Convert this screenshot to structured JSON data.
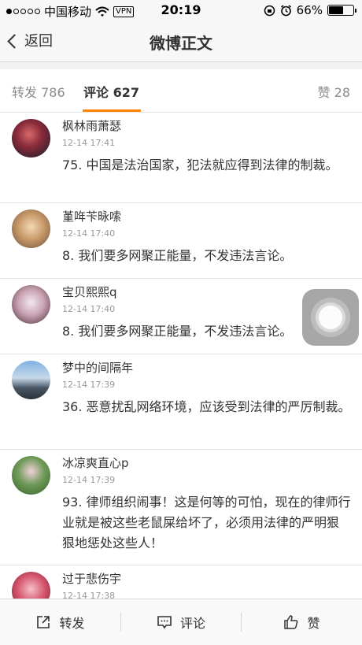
{
  "status": {
    "carrier": "中国移动",
    "vpn": "VPN",
    "time": "20:19",
    "battery": "66%",
    "battery_level": 0.66,
    "signal_bars": 1
  },
  "nav": {
    "back_label": "返回",
    "title": "微博正文"
  },
  "tabs": {
    "repost": "转发 786",
    "comments": "评论 627",
    "likes": "赞 28",
    "accent_color": "#ff8200"
  },
  "comments": [
    {
      "name": "枫林雨萧瑟",
      "time": "12-14 17:41",
      "text": "75. 中国是法治国家，犯法就应得到法律的制裁。"
    },
    {
      "name": "堇哖苄昹嗦",
      "time": "12-14 17:40",
      "text": "8. 我们要多网聚正能量，不发违法言论。"
    },
    {
      "name": "宝贝熙熙q",
      "time": "12-14 17:40",
      "text": "8. 我们要多网聚正能量，不发违法言论。"
    },
    {
      "name": "梦中的间隔年",
      "time": "12-14 17:39",
      "text": "36. 恶意扰乱网络环境，应该受到法律的严厉制裁。"
    },
    {
      "name": "冰凉爽直心p",
      "time": "12-14 17:39",
      "text": "93. 律师组织闹事！这是何等的可怕，现在的律师行业就是被这些老鼠屎给坏了，必须用法律的严明狠狠地惩处这些人！"
    },
    {
      "name": "过于悲伤宇",
      "time": "12-14 17:38",
      "text": ""
    }
  ],
  "toolbar": {
    "repost": "转发",
    "comment": "评论",
    "like": "赞"
  }
}
